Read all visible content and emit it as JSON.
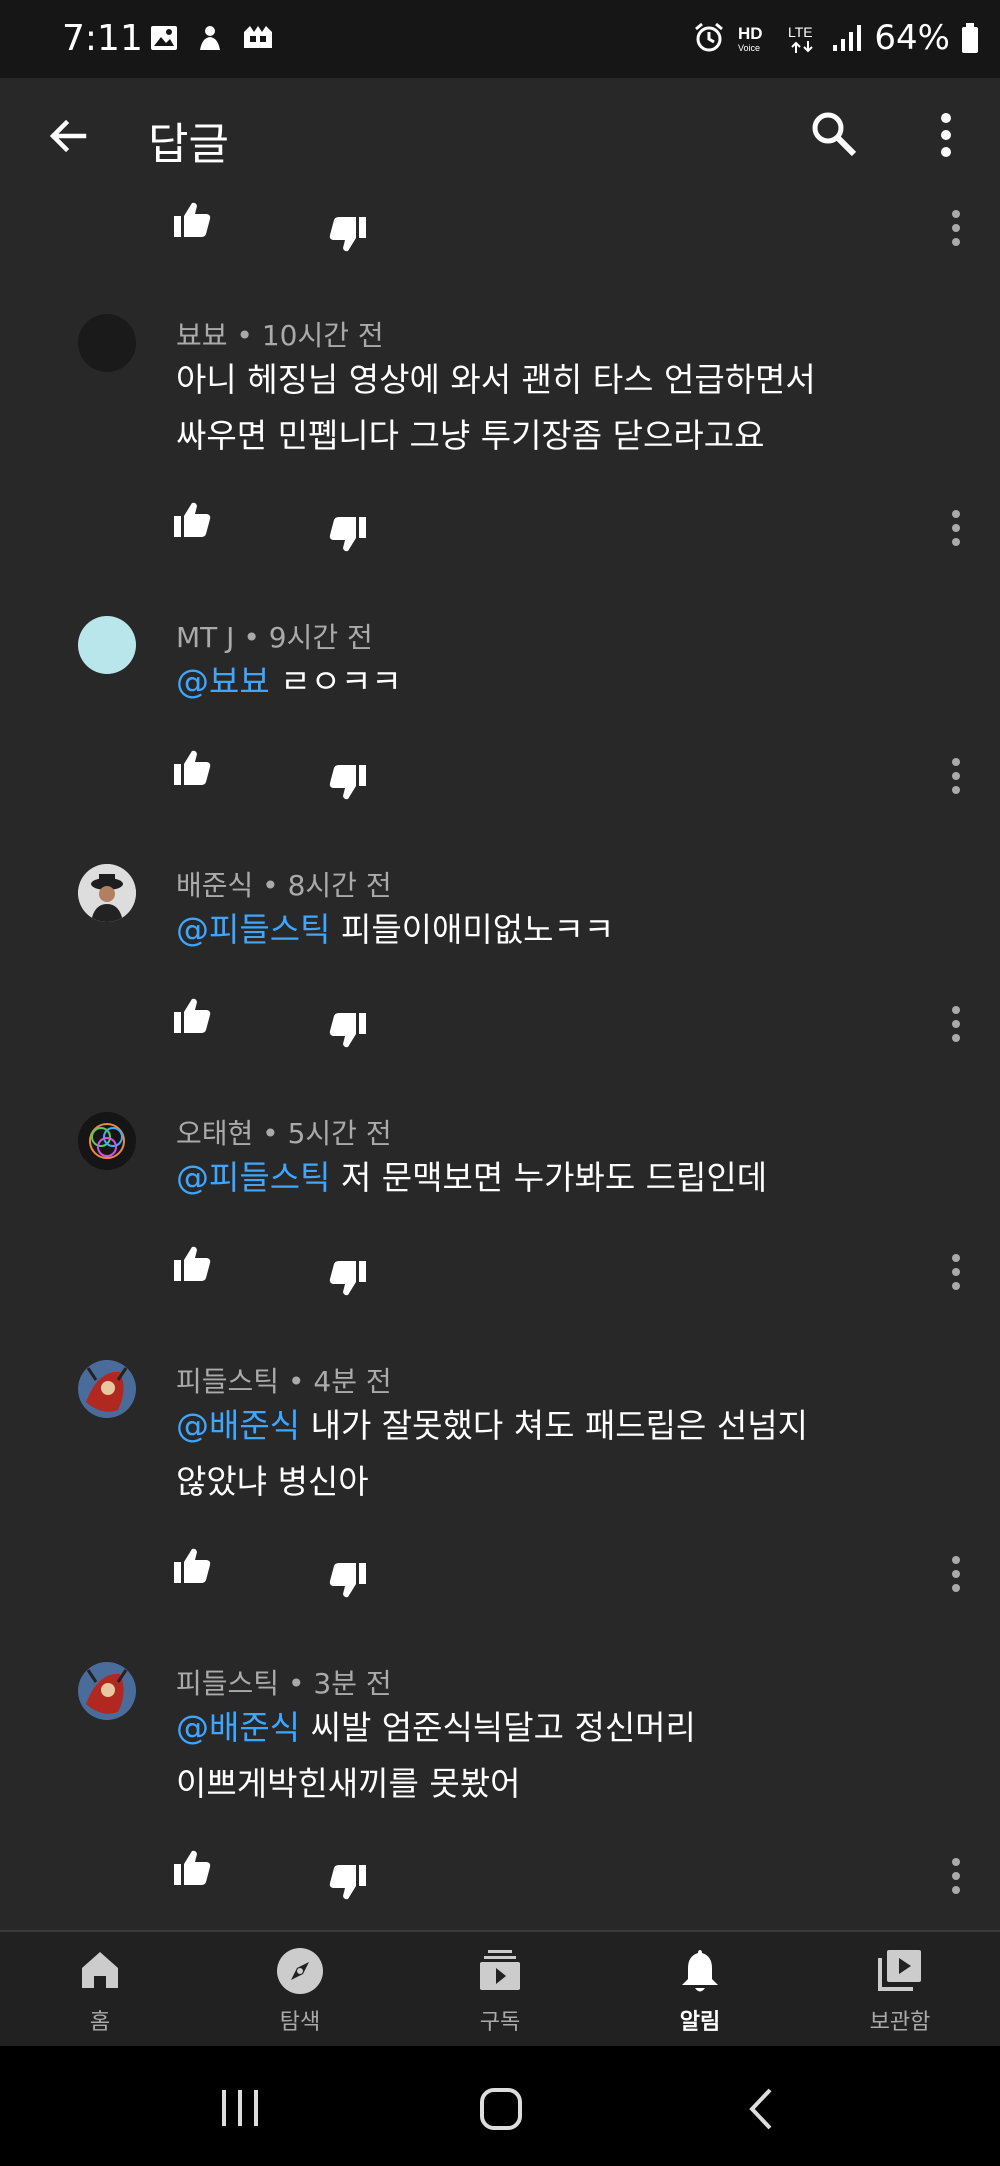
{
  "status_bar": {
    "time": "7:11",
    "battery": "64%"
  },
  "app_bar": {
    "title": "답글"
  },
  "comments": [
    {
      "author": "뵤뵤",
      "time": "10시간 전",
      "mention": "",
      "text_line1": "아니 헤징님 영상에 와서 괜히 타스 언급하면서",
      "text_line2": "싸우면 민폡니다 그냥 투기장좀 닫으라고요"
    },
    {
      "author": "MT J",
      "time": "9시간 전",
      "mention": "@뵤뵤",
      "text_line1": "ㄹㅇㅋㅋ",
      "text_line2": ""
    },
    {
      "author": "배준식",
      "time": "8시간 전",
      "mention": "@피들스틱",
      "text_line1": "피들이애미없노ㅋㅋ",
      "text_line2": ""
    },
    {
      "author": "오태현",
      "time": "5시간 전",
      "mention": "@피들스틱",
      "text_line1": "저 문맥보면 누가봐도 드립인데",
      "text_line2": ""
    },
    {
      "author": "피들스틱",
      "time": "4분 전",
      "mention": "@배준식",
      "text_line1": "내가 잘못했다 쳐도 패드립은 선넘지",
      "text_line2": "않았냐 병신아"
    },
    {
      "author": "피들스틱",
      "time": "3분 전",
      "mention": "@배준식",
      "text_line1": "씨발 엄준식늭달고 정신머리",
      "text_line2": "이쁘게박힌새끼를 못봤어"
    }
  ],
  "bottom_nav": [
    {
      "label": "홈",
      "icon": "home-icon"
    },
    {
      "label": "탐색",
      "icon": "explore-icon"
    },
    {
      "label": "구독",
      "icon": "subscriptions-icon"
    },
    {
      "label": "알림",
      "icon": "notifications-icon",
      "active": true
    },
    {
      "label": "보관함",
      "icon": "library-icon"
    }
  ],
  "colors": {
    "background": "#282828",
    "mention": "#3ea6ff",
    "meta": "#aaaaaa"
  }
}
